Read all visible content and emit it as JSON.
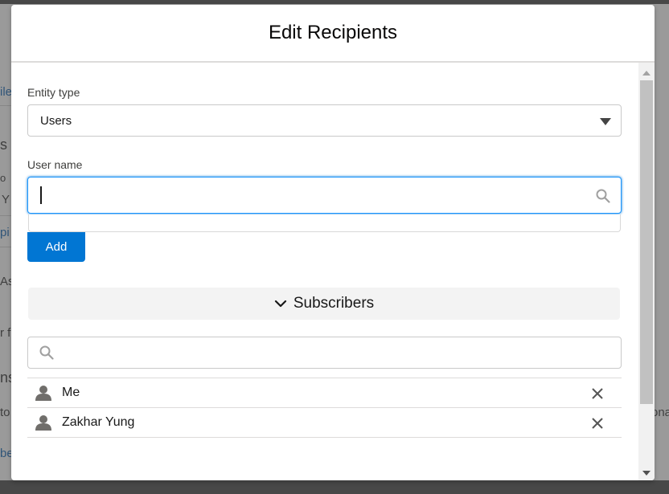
{
  "background": {
    "fragments": [
      "ile",
      "s",
      "o",
      "Y",
      "pi",
      "As",
      "r f",
      "ns",
      "to",
      "be",
      "ona"
    ]
  },
  "modal": {
    "title": "Edit Recipients",
    "entity_type": {
      "label": "Entity type",
      "selected": "Users"
    },
    "user_name": {
      "label": "User name",
      "value": "",
      "placeholder": ""
    },
    "add_button": "Add",
    "subscribers": {
      "section_label": "Subscribers",
      "filter_value": "",
      "items": [
        {
          "name": "Me"
        },
        {
          "name": "Zakhar Yung"
        }
      ]
    }
  },
  "colors": {
    "brand": "#0176d3",
    "focus_border": "#1b96ff",
    "section_bg": "#f3f3f3"
  },
  "icons": {
    "search": "search-icon",
    "chevron": "chevron-down-icon",
    "user": "user-icon",
    "remove": "close-icon"
  }
}
